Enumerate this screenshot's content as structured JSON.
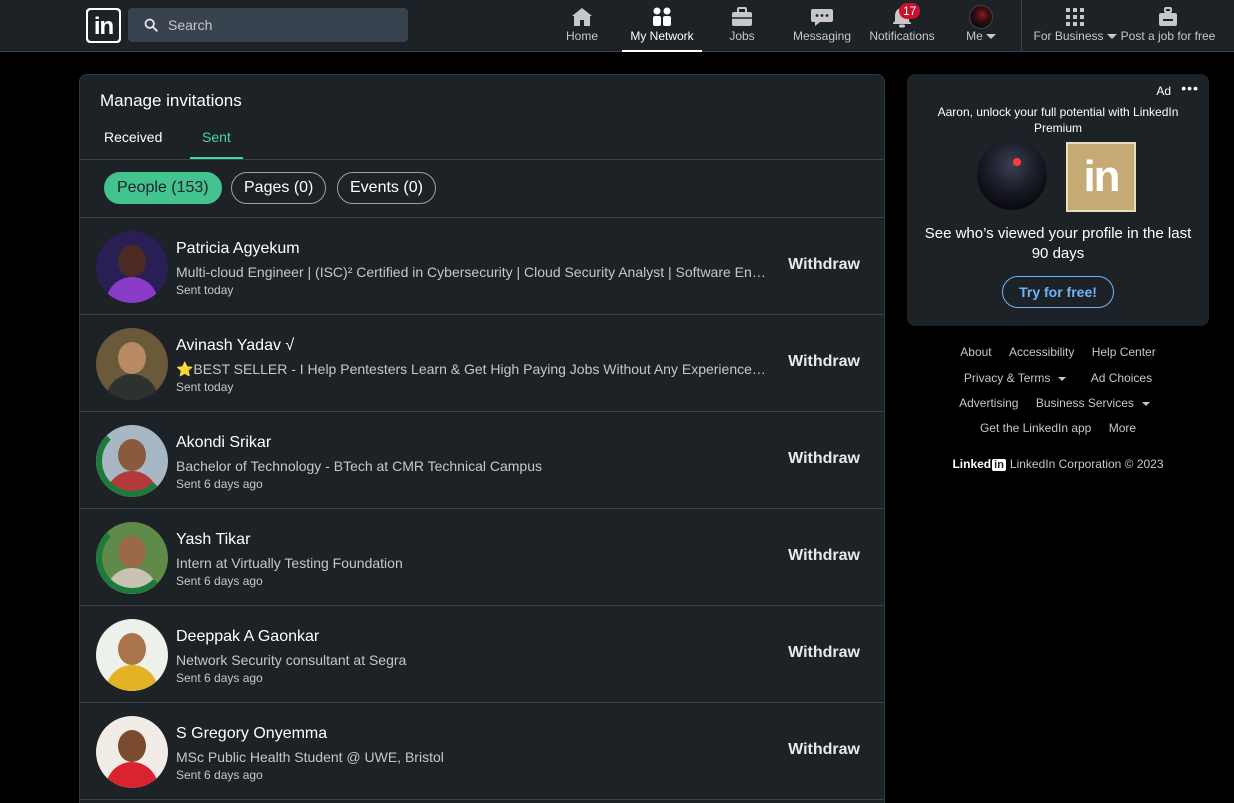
{
  "nav": {
    "logo": "in",
    "search_placeholder": "Search",
    "items": [
      {
        "label": "Home"
      },
      {
        "label": "My Network"
      },
      {
        "label": "Jobs"
      },
      {
        "label": "Messaging"
      },
      {
        "label": "Notifications",
        "badge": "17"
      },
      {
        "label": "Me"
      },
      {
        "label": "For Business"
      },
      {
        "label": "Post a job for free"
      }
    ]
  },
  "main": {
    "title": "Manage invitations",
    "tabs": [
      {
        "label": "Received"
      },
      {
        "label": "Sent"
      }
    ],
    "filters": [
      {
        "label": "People (153)"
      },
      {
        "label": "Pages (0)"
      },
      {
        "label": "Events (0)"
      }
    ],
    "withdraw_label": "Withdraw",
    "invitations": [
      {
        "name": "Patricia Agyekum",
        "headline": "Multi-cloud Engineer | (ISC)² Certified in Cybersecurity | Cloud Security Analyst | Software Engineer | AWS | Azure",
        "time": "Sent today"
      },
      {
        "name": "Avinash Yadav √",
        "headline": "⭐BEST SELLER - I Help Pentesters Learn & Get High Paying Jobs Without Any Experience By Teaching Them",
        "time": "Sent today"
      },
      {
        "name": "Akondi Srikar",
        "headline": "Bachelor of Technology - BTech at CMR Technical Campus",
        "time": "Sent 6 days ago"
      },
      {
        "name": "Yash Tikar",
        "headline": "Intern at Virtually Testing Foundation",
        "time": "Sent 6 days ago"
      },
      {
        "name": "Deeppak A Gaonkar",
        "headline": "Network Security consultant at Segra",
        "time": "Sent 6 days ago"
      },
      {
        "name": "S Gregory Onyemma",
        "headline": "MSc Public Health Student @ UWE, Bristol",
        "time": "Sent 6 days ago"
      }
    ]
  },
  "ad": {
    "label": "Ad",
    "menu": "•••",
    "text": "Aaron, unlock your full potential with LinkedIn Premium",
    "logo": "in",
    "headline": "See who’s viewed your profile in the last 90 days",
    "cta": "Try for free!"
  },
  "footer": {
    "links": [
      "About",
      "Accessibility",
      "Help Center",
      "Privacy & Terms",
      "Ad Choices",
      "Advertising",
      "Business Services",
      "Get the LinkedIn app",
      "More"
    ],
    "brand_word": "Linked",
    "brand_in": "in",
    "copyright": "LinkedIn Corporation © 2023"
  },
  "colors": {
    "accent_green": "#44c38f",
    "tab_green": "#44d8a1",
    "link_blue": "#70b5f9",
    "badge_red": "#cb112d",
    "card_bg": "#1d2226"
  },
  "icons": [
    "search-icon",
    "home-icon",
    "my-network-icon",
    "jobs-icon",
    "messaging-icon",
    "notifications-icon",
    "grid-icon",
    "post-job-icon",
    "more-options-icon"
  ]
}
